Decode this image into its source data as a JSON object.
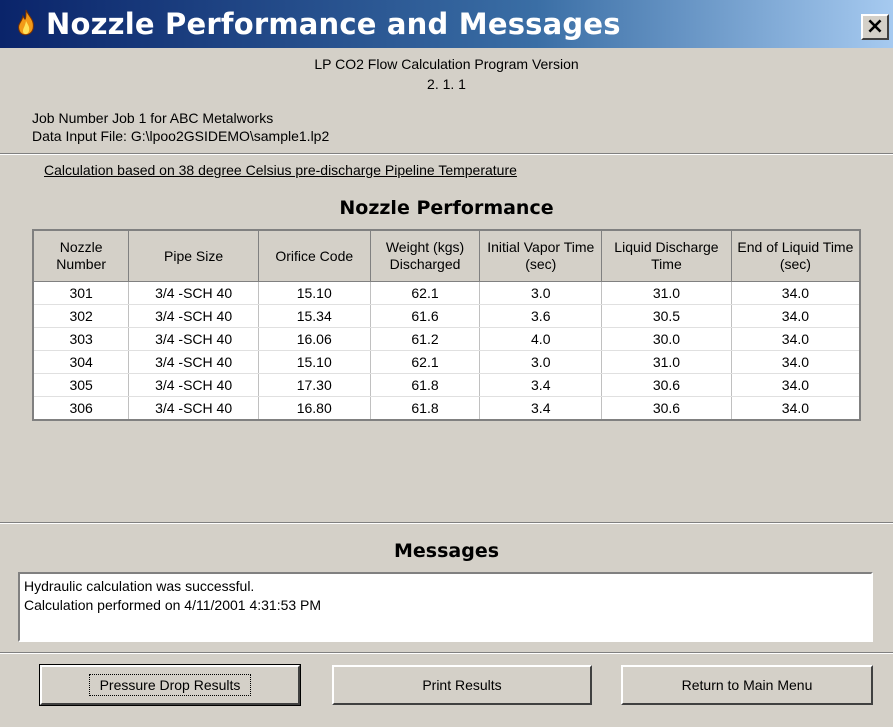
{
  "window": {
    "title": "Nozzle Performance and Messages",
    "close_label": "×"
  },
  "header": {
    "program_line": "LP CO2 Flow Calculation Program Version",
    "version": "2. 1. 1",
    "job_line": "Job Number Job 1  for ABC Metalworks",
    "data_file_line": "Data Input File: G:\\lpoo2GSIDEMO\\sample1.lp2"
  },
  "calc_basis": "Calculation based on  38 degree Celsius pre-discharge Pipeline Temperature",
  "nozzle_section": {
    "title": "Nozzle Performance",
    "columns": [
      "Nozzle Number",
      "Pipe Size",
      "Orifice Code",
      "Weight (kgs) Discharged",
      "Initial Vapor Time (sec)",
      "Liquid Discharge Time",
      "End of Liquid Time (sec)"
    ],
    "rows": [
      [
        "301",
        "3/4 -SCH 40",
        "15.10",
        "62.1",
        "3.0",
        "31.0",
        "34.0"
      ],
      [
        "302",
        "3/4 -SCH 40",
        "15.34",
        "61.6",
        "3.6",
        "30.5",
        "34.0"
      ],
      [
        "303",
        "3/4 -SCH 40",
        "16.06",
        "61.2",
        "4.0",
        "30.0",
        "34.0"
      ],
      [
        "304",
        "3/4 -SCH 40",
        "15.10",
        "62.1",
        "3.0",
        "31.0",
        "34.0"
      ],
      [
        "305",
        "3/4 -SCH 40",
        "17.30",
        "61.8",
        "3.4",
        "30.6",
        "34.0"
      ],
      [
        "306",
        "3/4 -SCH 40",
        "16.80",
        "61.8",
        "3.4",
        "30.6",
        "34.0"
      ]
    ]
  },
  "messages_section": {
    "title": "Messages",
    "lines": [
      "Hydraulic calculation was successful.",
      "Calculation performed on 4/11/2001 4:31:53 PM"
    ]
  },
  "buttons": {
    "pressure_drop": "Pressure Drop Results",
    "print": "Print Results",
    "return": "Return to Main Menu"
  },
  "icons": {
    "app": "flame-icon",
    "close": "close-icon"
  },
  "colors": {
    "title_bar_start": "#0a246a",
    "title_bar_end": "#a6caf0",
    "dialog_bg": "#d4d0c8"
  }
}
